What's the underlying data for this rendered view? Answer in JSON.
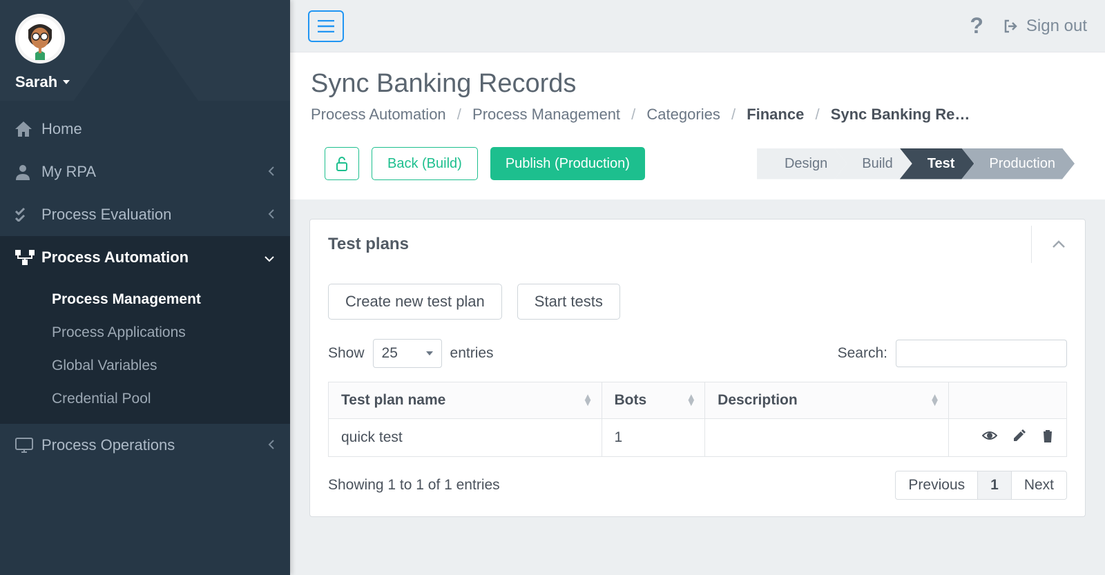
{
  "user": {
    "name": "Sarah"
  },
  "topbar": {
    "help": "?",
    "signout": "Sign out"
  },
  "sidebar": {
    "home": "Home",
    "myrpa": "My RPA",
    "processEval": "Process Evaluation",
    "processAuto": "Process Automation",
    "processOps": "Process Operations",
    "sub": {
      "mgmt": "Process Management",
      "apps": "Process Applications",
      "globals": "Global Variables",
      "creds": "Credential Pool"
    }
  },
  "page": {
    "title": "Sync Banking Records",
    "breadcrumbs": [
      "Process Automation",
      "Process Management",
      "Categories",
      "Finance",
      "Sync Banking Re…"
    ]
  },
  "actions": {
    "back": "Back (Build)",
    "publish": "Publish (Production)"
  },
  "steps": [
    "Design",
    "Build",
    "Test",
    "Production"
  ],
  "panel": {
    "title": "Test plans",
    "createBtn": "Create new test plan",
    "startBtn": "Start tests",
    "showLabel": "Show",
    "pageSize": "25",
    "entriesLabel": "entries",
    "searchLabel": "Search:",
    "cols": [
      "Test plan name",
      "Bots",
      "Description"
    ],
    "rows": [
      {
        "name": "quick test",
        "bots": "1",
        "desc": ""
      }
    ],
    "footerText": "Showing 1 to 1 of 1 entries",
    "pager": {
      "prev": "Previous",
      "page": "1",
      "next": "Next"
    }
  }
}
